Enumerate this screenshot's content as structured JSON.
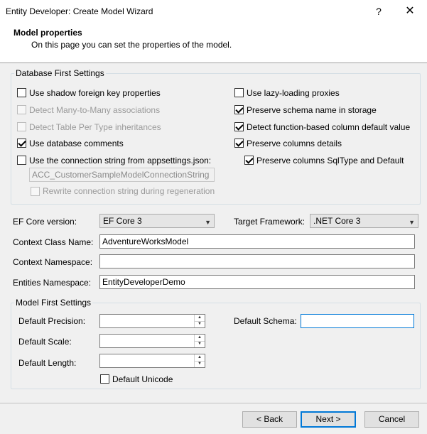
{
  "window": {
    "title": "Entity Developer: Create Model Wizard",
    "help_glyph": "?",
    "close_glyph": "✕"
  },
  "header": {
    "title": "Model properties",
    "subtitle": "On this page you can set the properties of the model."
  },
  "db_first": {
    "group_label": "Database First Settings",
    "left": [
      {
        "label": "Use  shadow foreign key properties",
        "checked": false,
        "enabled": true
      },
      {
        "label": "Detect Many-to-Many associations",
        "checked": false,
        "enabled": false
      },
      {
        "label": "Detect Table Per Type inheritances",
        "checked": false,
        "enabled": false
      },
      {
        "label": "Use database comments",
        "checked": true,
        "enabled": true
      },
      {
        "label": "Use the connection string from appsettings.json:",
        "checked": false,
        "enabled": true
      }
    ],
    "connection_string": "ACC_CustomerSampleModelConnectionString",
    "rewrite_label": "Rewrite connection string during regeneration",
    "right": [
      {
        "label": "Use lazy-loading proxies",
        "checked": false,
        "enabled": true
      },
      {
        "label": "Preserve schema name in storage",
        "checked": true,
        "enabled": true
      },
      {
        "label": "Detect function-based column default value",
        "checked": true,
        "enabled": true
      },
      {
        "label": "Preserve columns details",
        "checked": true,
        "enabled": true
      },
      {
        "label": "Preserve columns SqlType and Default",
        "checked": true,
        "enabled": true
      }
    ]
  },
  "ef_core": {
    "label": "EF Core version:",
    "value": "EF Core 3"
  },
  "target_framework": {
    "label": "Target Framework:",
    "value": ".NET Core 3"
  },
  "context_class": {
    "label": "Context Class Name:",
    "value": "AdventureWorksModel"
  },
  "context_namespace": {
    "label": "Context Namespace:",
    "value": ""
  },
  "entities_namespace": {
    "label": "Entities Namespace:",
    "value": "EntityDeveloperDemo"
  },
  "model_first": {
    "group_label": "Model First Settings",
    "precision_label": "Default Precision:",
    "scale_label": "Default Scale:",
    "length_label": "Default Length:",
    "schema_label": "Default Schema:",
    "unicode_label": "Default Unicode",
    "unicode_checked": false
  },
  "buttons": {
    "back": "< Back",
    "next": "Next >",
    "cancel": "Cancel"
  }
}
